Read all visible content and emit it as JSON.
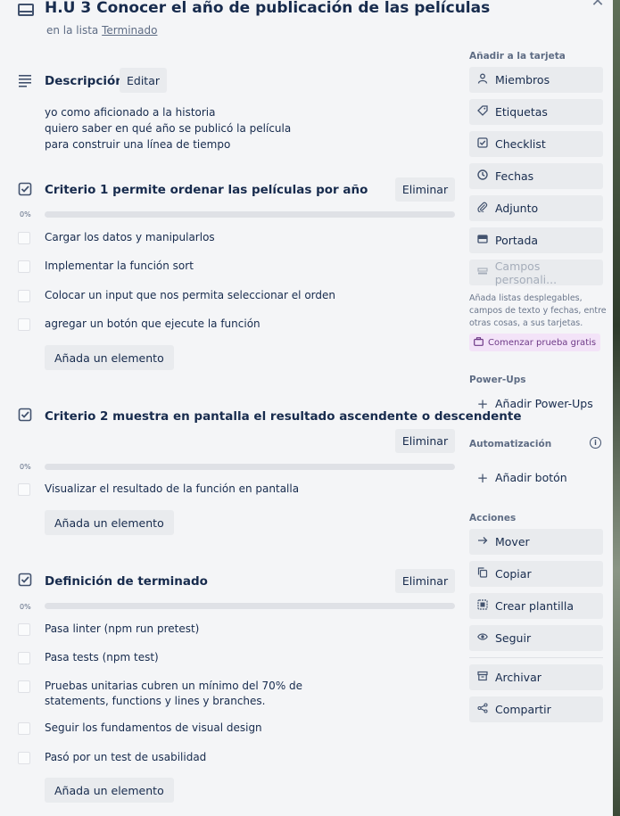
{
  "card": {
    "title": "H.U 3 Conocer el año de publicación de las películas",
    "list_prefix": "en la lista",
    "list_name": "Terminado"
  },
  "description": {
    "heading": "Descripción",
    "edit_label": "Editar",
    "lines": [
      "yo como aficionado a la historia",
      "quiero saber en qué año se publicó la película",
      "para construir una línea de tiempo"
    ]
  },
  "checklists": [
    {
      "title": "Criterio 1 permite ordenar las películas por año",
      "delete_label": "Eliminar",
      "progress": "0%",
      "progress_value": 0,
      "items": [
        "Cargar los datos y manipularlos",
        "Implementar la función sort",
        "Colocar un input que nos permita seleccionar el orden",
        "agregar un botón que ejecute la función"
      ],
      "add_label": "Añada un elemento"
    },
    {
      "title": "Criterio 2 muestra en pantalla el resultado ascendente o descendente",
      "delete_label": "Eliminar",
      "progress": "0%",
      "progress_value": 0,
      "items": [
        "Visualizar el resultado de la función en pantalla"
      ],
      "add_label": "Añada un elemento"
    },
    {
      "title": "Definición de terminado",
      "delete_label": "Eliminar",
      "progress": "0%",
      "progress_value": 0,
      "items": [
        "Pasa linter (npm run pretest)",
        "Pasa tests (npm test)",
        "Pruebas unitarias cubren un mínimo del 70% de statements, functions y lines y branches.",
        "Seguir los fundamentos de visual design",
        "Pasó por un test de usabilidad"
      ],
      "add_label": "Añada un elemento"
    }
  ],
  "sidebar": {
    "add_to_card_heading": "Añadir a la tarjeta",
    "add_to_card": [
      {
        "label": "Miembros",
        "icon": "person-icon"
      },
      {
        "label": "Etiquetas",
        "icon": "tag-icon"
      },
      {
        "label": "Checklist",
        "icon": "checklist-icon"
      },
      {
        "label": "Fechas",
        "icon": "clock-icon"
      },
      {
        "label": "Adjunto",
        "icon": "paperclip-icon"
      },
      {
        "label": "Portada",
        "icon": "cover-icon"
      },
      {
        "label": "Campos personali...",
        "icon": "custom-fields-icon"
      }
    ],
    "custom_fields_hint": "Añada listas desplegables, campos de texto y fechas, entre otras cosas, a sus tarjetas.",
    "trial_label": "Comenzar prueba gratis",
    "powerups_heading": "Power-Ups",
    "add_powerups_label": "Añadir Power-Ups",
    "automation_heading": "Automatización",
    "add_button_label": "Añadir botón",
    "actions_heading": "Acciones",
    "actions": [
      {
        "label": "Mover",
        "icon": "arrow-right-icon"
      },
      {
        "label": "Copiar",
        "icon": "copy-icon"
      },
      {
        "label": "Crear plantilla",
        "icon": "template-icon"
      },
      {
        "label": "Seguir",
        "icon": "eye-icon"
      },
      {
        "label": "Archivar",
        "icon": "archive-icon"
      },
      {
        "label": "Compartir",
        "icon": "share-icon"
      }
    ]
  },
  "colors": {
    "modal_bg": "#f4f5f7",
    "button_bg": "#e9ebee",
    "text": "#172b4d",
    "muted": "#5e6c84",
    "trial_bg": "#f3e3f8"
  }
}
